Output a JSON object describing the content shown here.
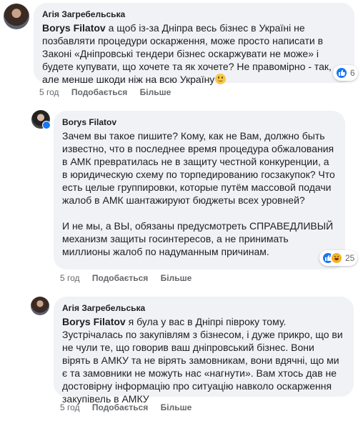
{
  "comments": [
    {
      "author": "Агія Загребельська",
      "tag": "Borys Filatov",
      "text": " а щоб із-за Дніпра весь бізнес в Україні не позбавляти процедури оскарження, може просто написати в Законі «Дніпровські тендери бізнес оскаржувати не може» і будете купувати, що хочете та як хочете? Не правомірно - так, але менше шкоди ніж на всю Україну",
      "emoji": "smile-emoji",
      "reaction_count": "6",
      "actions": {
        "time": "5 год",
        "like": "Подобається",
        "more": "Більше"
      }
    },
    {
      "author": "Borys Filatov",
      "paragraph1": "Зачем вы такое пишите? Кому, как не Вам, должно быть известно, что в последнее время процедура обжалования в АМК превратилась не в защиту честной конкуренции, а в юридическую схему по торпедированию госзакупок? Что есть целые группировки, которые путём массовой подачи жалоб в АМК шантажируют бюджеты всех уровней?",
      "paragraph2": "И не мы, а ВЫ, обязаны предусмотреть СПРАВЕДЛИВЫЙ механизм защиты госинтересов, а не принимать миллионы жалоб по надуманным причинам.",
      "reaction_count": "25",
      "actions": {
        "time": "5 год",
        "like": "Подобається",
        "more": "Більше"
      }
    },
    {
      "author": "Агія Загребельська",
      "tag": "Borys Filatov",
      "text": " я була у вас в Дніпрі півроку тому. Зустрічалась по закупівлям з бізнесом, і дуже прикро, що ви не чули те, що говорив ваш дніпровський бізнес. Вони вірять в АМКУ та не вірять замовникам, вони вдячні, що ми є та замовники не можуть нас «нагнути». Вам хтось дав не достовірну інформацію про ситуацію навколо оскарження закупівель в АМКУ",
      "actions": {
        "time": "5 год",
        "like": "Подобається",
        "more": "Більше"
      }
    }
  ],
  "colors": {
    "bubble": "#f0f2f5",
    "like_blue": "#1877f2",
    "meta_gray": "#65676b",
    "haha_yellow": "#f7b125"
  }
}
